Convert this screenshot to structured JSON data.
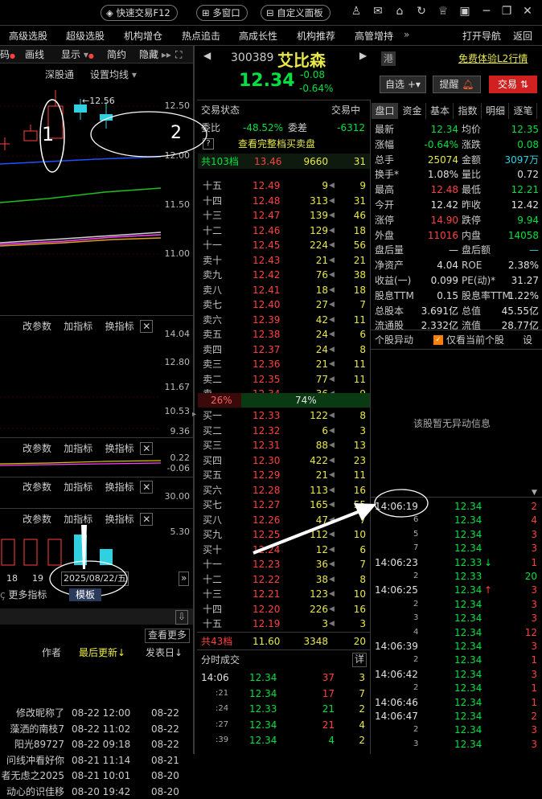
{
  "topbar": {
    "quick_trade": "快速交易F12",
    "multi_window": "多窗口",
    "custom_panel": "自定义面板"
  },
  "menubar": {
    "items": [
      "高级选股",
      "超级选股",
      "机构增仓",
      "热点追击",
      "高成长性",
      "机构推荐",
      "高管增持"
    ],
    "more": "»",
    "nav": "打开导航",
    "back": "返回"
  },
  "left": {
    "toolbar": {
      "code": "码",
      "line_draw": "画线",
      "display": "显示",
      "simple": "简约",
      "hide": "隐藏"
    },
    "chart_menu": {
      "shentong": "深股通",
      "ma_setting": "设置均线"
    },
    "price_axis": [
      "12.50",
      "12.00",
      "11.50",
      "11.00"
    ],
    "high_label": "←12.56",
    "panel1": {
      "params": "改参数",
      "add": "加指标",
      "switch": "换指标",
      "axis": [
        "14.04",
        "12.80",
        "11.67",
        "10.53",
        "9.36"
      ]
    },
    "panel2": {
      "params": "改参数",
      "add": "加指标",
      "switch": "换指标",
      "axis": [
        "0.22",
        "-0.06"
      ]
    },
    "panel3": {
      "params": "改参数",
      "add": "加指标",
      "switch": "换指标",
      "axis": [
        "30.00",
        "5.30"
      ]
    },
    "x_labels": [
      "18",
      "19"
    ],
    "date_label": "2025/08/22/五",
    "bottom_tabs": {
      "more": "更多指标",
      "template": "模板"
    },
    "news": {
      "view_more": "查看更多",
      "col_author": "作者",
      "col_updated": "最后更新",
      "col_posted": "发表日",
      "rows": [
        [
          "修改昵称了",
          "08-22 12:00",
          "08-22"
        ],
        [
          "藻洒的南枝7",
          "08-22 11:02",
          "08-22"
        ],
        [
          "阳光89727",
          "08-22 09:18",
          "08-22"
        ],
        [
          "问线冲看好你",
          "08-21 11:14",
          "08-21"
        ],
        [
          "者无虑之2025",
          "08-21 10:01",
          "08-20"
        ],
        [
          "动心的识佳移",
          "08-20 19:42",
          "08-20"
        ]
      ]
    }
  },
  "annotations": {
    "one": "1",
    "two": "2"
  },
  "stock": {
    "code": "300389",
    "name": "艾比森",
    "price": "12.34",
    "change": "-0.08",
    "change_pct": "-0.64%",
    "market": "港",
    "l2": "免费体验L2行情",
    "self_select": "自选",
    "remind": "提醒",
    "trade": "交易"
  },
  "orderbook": {
    "status_label": "交易状态",
    "status_value": "交易中",
    "ratio_label": "委比",
    "ratio_value": "-48.52%",
    "diff_label": "委差",
    "diff_value": "-6312",
    "view_full": "查看完整档买卖盘",
    "sell_total": {
      "label": "共103档",
      "price": "13.46",
      "vol": "9660",
      "num": "31"
    },
    "sells": [
      [
        "十五",
        "12.49",
        "9",
        "9"
      ],
      [
        "十四",
        "12.48",
        "313",
        "31"
      ],
      [
        "十三",
        "12.47",
        "139",
        "46"
      ],
      [
        "十二",
        "12.46",
        "129",
        "18"
      ],
      [
        "十一",
        "12.45",
        "224",
        "56"
      ],
      [
        "卖十",
        "12.43",
        "21",
        "21"
      ],
      [
        "卖九",
        "12.42",
        "76",
        "38"
      ],
      [
        "卖八",
        "12.41",
        "18",
        "18"
      ],
      [
        "卖七",
        "12.40",
        "27",
        "7"
      ],
      [
        "卖六",
        "12.39",
        "42",
        "11"
      ],
      [
        "卖五",
        "12.38",
        "24",
        "6"
      ],
      [
        "卖四",
        "12.37",
        "24",
        "8"
      ],
      [
        "卖三",
        "12.36",
        "21",
        "11"
      ],
      [
        "卖二",
        "12.35",
        "77",
        "11"
      ],
      [
        "卖一",
        "12.34",
        "36",
        "9"
      ]
    ],
    "ratio_bar": {
      "sell_pct": "26%",
      "buy_pct": "74%"
    },
    "buys": [
      [
        "买一",
        "12.33",
        "122",
        "8"
      ],
      [
        "买二",
        "12.32",
        "6",
        "3"
      ],
      [
        "买三",
        "12.31",
        "88",
        "13"
      ],
      [
        "买四",
        "12.30",
        "422",
        "23"
      ],
      [
        "买五",
        "12.29",
        "21",
        "11"
      ],
      [
        "买六",
        "12.28",
        "113",
        "16"
      ],
      [
        "买七",
        "12.27",
        "165",
        "55"
      ],
      [
        "买八",
        "12.26",
        "47",
        "7"
      ],
      [
        "买九",
        "12.25",
        "112",
        "10"
      ],
      [
        "买十",
        "12.24",
        "12",
        "6"
      ],
      [
        "十一",
        "12.23",
        "36",
        "7"
      ],
      [
        "十二",
        "12.22",
        "38",
        "8"
      ],
      [
        "十三",
        "12.21",
        "123",
        "10"
      ],
      [
        "十四",
        "12.20",
        "226",
        "16"
      ],
      [
        "十五",
        "12.19",
        "3",
        "3"
      ]
    ],
    "buy_total": {
      "label": "共43档",
      "price": "11.60",
      "vol": "3348",
      "num": "20"
    }
  },
  "ticks": {
    "title": "分时成交",
    "detail": "详",
    "rows": [
      [
        "14:06",
        "12.34",
        "37",
        "3"
      ],
      [
        ":21",
        "12.34",
        "17",
        "7"
      ],
      [
        ":24",
        "12.33",
        "21",
        "2"
      ],
      [
        ":27",
        "12.34",
        "21",
        "4"
      ],
      [
        ":39",
        "12.34",
        "4",
        "2"
      ]
    ]
  },
  "quote": {
    "tabs": [
      "盘口",
      "资金",
      "基本",
      "指数",
      "明细",
      "逐笔"
    ],
    "rows": [
      [
        "最新",
        "12.34",
        "均价",
        "12.35"
      ],
      [
        "涨幅",
        "-0.64%",
        "涨跌",
        "0.08"
      ],
      [
        "总手",
        "25074",
        "金额",
        "3097万"
      ],
      [
        "换手*",
        "1.08%",
        "量比",
        "0.72"
      ],
      [
        "最高",
        "12.48",
        "最低",
        "12.21"
      ],
      [
        "今开",
        "12.42",
        "昨收",
        "12.42"
      ],
      [
        "涨停",
        "14.90",
        "跌停",
        "9.94"
      ],
      [
        "外盘",
        "11016",
        "内盘",
        "14058"
      ],
      [
        "盘后量",
        "—",
        "盘后额",
        "—"
      ],
      [
        "净资产",
        "4.04",
        "ROE",
        "2.38%"
      ],
      [
        "收益(一)",
        "0.099",
        "PE(动)*",
        "31.27"
      ],
      [
        "股息TTM",
        "0.15",
        "股息率TTM",
        "1.22%"
      ],
      [
        "总股本",
        "3.691亿",
        "总值",
        "45.55亿"
      ],
      [
        "流通股",
        "2.332亿",
        "流值",
        "28.77亿"
      ]
    ]
  },
  "anomaly": {
    "title": "个股异动",
    "only_current": "仅看当前个股",
    "settings": "设",
    "empty": "该股暂无异动信息"
  },
  "trades": [
    [
      "14:06:19",
      "12.34",
      "2"
    ],
    [
      "6",
      "12.34",
      "4"
    ],
    [
      "5",
      "12.34",
      "3"
    ],
    [
      "7",
      "12.34",
      "3"
    ],
    [
      "14:06:23",
      "12.33",
      "1"
    ],
    [
      "2",
      "12.33",
      "20"
    ],
    [
      "14:06:25",
      "12.34",
      "3"
    ],
    [
      "2",
      "12.34",
      "3"
    ],
    [
      "3",
      "12.34",
      "3"
    ],
    [
      "4",
      "12.34",
      "12"
    ],
    [
      "14:06:39",
      "12.34",
      "3"
    ],
    [
      "2",
      "12.34",
      "1"
    ],
    [
      "14:06:42",
      "12.34",
      "3"
    ],
    [
      "2",
      "12.34",
      "1"
    ],
    [
      "14:06:46",
      "12.34",
      "1"
    ],
    [
      "14:06:47",
      "12.34",
      "2"
    ],
    [
      "2",
      "12.34",
      "3"
    ],
    [
      "3",
      "12.34",
      "3"
    ]
  ]
}
